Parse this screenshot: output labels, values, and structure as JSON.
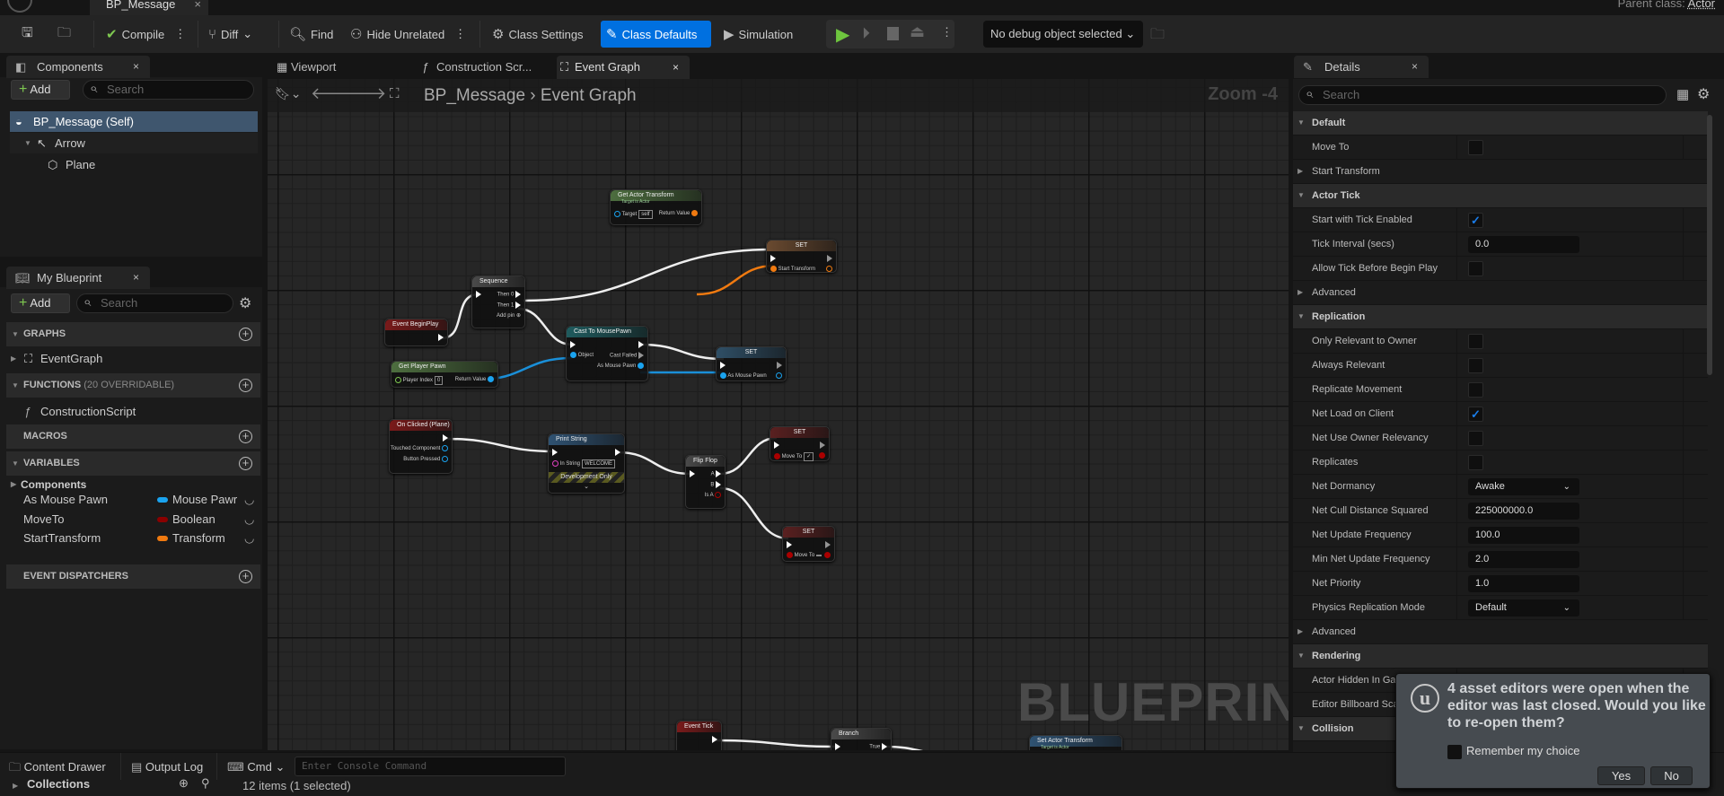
{
  "titlebar": {
    "doc_tab": "BP_Message",
    "parent_label": "Parent class:",
    "parent_value": "Actor"
  },
  "toolbar": {
    "compile": "Compile",
    "diff": "Diff",
    "find": "Find",
    "hide_unrelated": "Hide Unrelated",
    "class_settings": "Class Settings",
    "class_defaults": "Class Defaults",
    "simulation": "Simulation",
    "debug_object": "No debug object selected",
    "accent": "#0070e0"
  },
  "components": {
    "tab": "Components",
    "add": "Add",
    "search_placeholder": "Search",
    "items": [
      "BP_Message (Self)",
      "Arrow",
      "Plane"
    ]
  },
  "my_blueprint": {
    "tab": "My Blueprint",
    "add": "Add",
    "search_placeholder": "Search",
    "graphs": "GRAPHS",
    "graph_items": [
      "EventGraph"
    ],
    "functions": "FUNCTIONS",
    "functions_note": "(20 OVERRIDABLE)",
    "function_items": [
      "ConstructionScript"
    ],
    "macros": "MACROS",
    "variables": "VARIABLES",
    "components_group": "Components",
    "variables_list": [
      {
        "name": "As Mouse Pawn",
        "type": "Mouse Pawr",
        "color": "#1aa3ef"
      },
      {
        "name": "MoveTo",
        "type": "Boolean",
        "color": "#8b0000"
      },
      {
        "name": "StartTransform",
        "type": "Transform",
        "color": "#f07a10"
      }
    ],
    "event_dispatchers": "EVENT DISPATCHERS"
  },
  "graph_tabs": [
    "Viewport",
    "Construction Scr...",
    "Event Graph"
  ],
  "breadcrumb": {
    "root": "BP_Message",
    "current": "Event Graph",
    "zoom": "Zoom -4"
  },
  "watermark": "BLUEPRINT",
  "graph": {
    "nodes": [
      {
        "id": "gat",
        "title": "Get Actor Transform",
        "subtitle": "Target is Actor",
        "color": "#4d6e3f",
        "in": [
          {
            "l": "Target",
            "v": "self",
            "t": "blue-o"
          }
        ],
        "out": [
          {
            "l": "Return Value",
            "t": "orange"
          }
        ]
      },
      {
        "id": "set1",
        "title": "SET",
        "color": "#6a4a30",
        "in": [
          {
            "l": "",
            "t": "exec"
          },
          {
            "l": "Start Transform",
            "t": "orange"
          }
        ],
        "out": [
          {
            "l": "",
            "t": "exec-o"
          },
          {
            "l": "",
            "t": "orange-o"
          }
        ]
      },
      {
        "id": "seq",
        "title": "Sequence",
        "color": "#4a4a4a",
        "in": [
          {
            "l": "",
            "t": "exec"
          }
        ],
        "out": [
          {
            "l": "Then 0",
            "t": "exec"
          },
          {
            "l": "Then 1",
            "t": "exec"
          },
          {
            "l": "Add pin",
            "t": "add"
          }
        ]
      },
      {
        "id": "bp",
        "title": "Event BeginPlay",
        "color": "#7a1a1a",
        "in": [],
        "out": [
          {
            "l": "",
            "t": "exec"
          }
        ]
      },
      {
        "id": "cast",
        "title": "Cast To MousePawn",
        "color": "#1f5b5e",
        "in": [
          {
            "l": "",
            "t": "exec"
          },
          {
            "l": "Object",
            "t": "blue"
          }
        ],
        "out": [
          {
            "l": "",
            "t": "exec"
          },
          {
            "l": "Cast Failed",
            "t": "exec-o"
          },
          {
            "l": "As Mouse Pawn",
            "t": "blue"
          }
        ]
      },
      {
        "id": "set2",
        "title": "SET",
        "color": "#2f4f66",
        "in": [
          {
            "l": "",
            "t": "exec"
          },
          {
            "l": "As Mouse Pawn",
            "t": "blue"
          }
        ],
        "out": [
          {
            "l": "",
            "t": "exec-o"
          },
          {
            "l": "",
            "t": "blue-o"
          }
        ]
      },
      {
        "id": "gpp",
        "title": "Get Player Pawn",
        "color": "#4d6e3f",
        "in": [
          {
            "l": "Player Index",
            "v": "0",
            "t": "green-o"
          }
        ],
        "out": [
          {
            "l": "Return Value",
            "t": "blue"
          }
        ]
      },
      {
        "id": "click",
        "title": "On Clicked (Plane)",
        "color": "#7a1a1a",
        "in": [],
        "out": [
          {
            "l": "",
            "t": "exec"
          },
          {
            "l": "Touched Component",
            "t": "blue-o"
          },
          {
            "l": "Button Pressed",
            "t": "blue-o"
          }
        ]
      },
      {
        "id": "print",
        "title": "Print String",
        "color": "#2f5272",
        "in": [
          {
            "l": "",
            "t": "exec"
          },
          {
            "l": "In String",
            "v": "WELCOME",
            "t": "pink-o"
          }
        ],
        "out": [
          {
            "l": "",
            "t": "exec"
          }
        ],
        "banner": "Development Only"
      },
      {
        "id": "ff",
        "title": "Flip Flop",
        "color": "#4a4a4a",
        "in": [
          {
            "l": "",
            "t": "exec"
          }
        ],
        "out": [
          {
            "l": "A",
            "t": "exec"
          },
          {
            "l": "B",
            "t": "exec"
          },
          {
            "l": "Is A",
            "t": "red-o"
          }
        ]
      },
      {
        "id": "set3",
        "title": "SET",
        "color": "#5a2020",
        "in": [
          {
            "l": "",
            "t": "exec"
          },
          {
            "l": "Move To",
            "v": "✓",
            "t": "red"
          }
        ],
        "out": [
          {
            "l": "",
            "t": "exec-o"
          },
          {
            "l": "",
            "t": "red"
          }
        ]
      },
      {
        "id": "set4",
        "title": "SET",
        "color": "#5a2020",
        "in": [
          {
            "l": "",
            "t": "exec"
          },
          {
            "l": "Move To",
            "v": " ",
            "t": "red"
          }
        ],
        "out": [
          {
            "l": "",
            "t": "exec-o"
          },
          {
            "l": "",
            "t": "red"
          }
        ]
      },
      {
        "id": "tick",
        "title": "Event Tick",
        "color": "#7a1a1a",
        "in": [],
        "out": [
          {
            "l": "",
            "t": "exec"
          }
        ]
      },
      {
        "id": "branch",
        "title": "Branch",
        "color": "#4a4a4a",
        "in": [
          {
            "l": "",
            "t": "exec"
          }
        ],
        "out": [
          {
            "l": "True",
            "t": "exec"
          }
        ]
      },
      {
        "id": "sat",
        "title": "Set Actor Transform",
        "subtitle": "Target is Actor",
        "color": "#2f5272",
        "in": [],
        "out": []
      }
    ]
  },
  "details": {
    "tab": "Details",
    "search_placeholder": "Search",
    "rows": [
      {
        "k": "s",
        "label": "Default"
      },
      {
        "label": "Move To",
        "check": false
      },
      {
        "k": "e",
        "label": "Start Transform"
      },
      {
        "k": "s",
        "label": "Actor Tick"
      },
      {
        "label": "Start with Tick Enabled",
        "check": true
      },
      {
        "label": "Tick Interval (secs)",
        "value": "0.0"
      },
      {
        "label": "Allow Tick Before Begin Play",
        "check": false
      },
      {
        "k": "e",
        "label": "Advanced"
      },
      {
        "k": "s",
        "label": "Replication"
      },
      {
        "label": "Only Relevant to Owner",
        "check": false
      },
      {
        "label": "Always Relevant",
        "check": false
      },
      {
        "label": "Replicate Movement",
        "check": false
      },
      {
        "label": "Net Load on Client",
        "check": true
      },
      {
        "label": "Net Use Owner Relevancy",
        "check": false
      },
      {
        "label": "Replicates",
        "check": false
      },
      {
        "label": "Net Dormancy",
        "value": "Awake",
        "dropdown": true
      },
      {
        "label": "Net Cull Distance Squared",
        "value": "225000000.0"
      },
      {
        "label": "Net Update Frequency",
        "value": "100.0"
      },
      {
        "label": "Min Net Update Frequency",
        "value": "2.0"
      },
      {
        "label": "Net Priority",
        "value": "1.0"
      },
      {
        "label": "Physics Replication Mode",
        "value": "Default",
        "dropdown": true
      },
      {
        "k": "e",
        "label": "Advanced"
      },
      {
        "k": "s",
        "label": "Rendering"
      },
      {
        "label": "Actor Hidden In Game"
      },
      {
        "label": "Editor Billboard Scale"
      },
      {
        "k": "s",
        "label": "Collision"
      }
    ]
  },
  "bottom": {
    "content_drawer": "Content Drawer",
    "output_log": "Output Log",
    "cmd": "Cmd",
    "console_placeholder": "Enter Console Command",
    "collections": "Collections",
    "items_status": "12 items (1 selected)"
  },
  "notification": {
    "message": "4 asset editors were open when the editor was last closed. Would you like to re-open them?",
    "remember": "Remember my choice",
    "yes": "Yes",
    "no": "No"
  }
}
